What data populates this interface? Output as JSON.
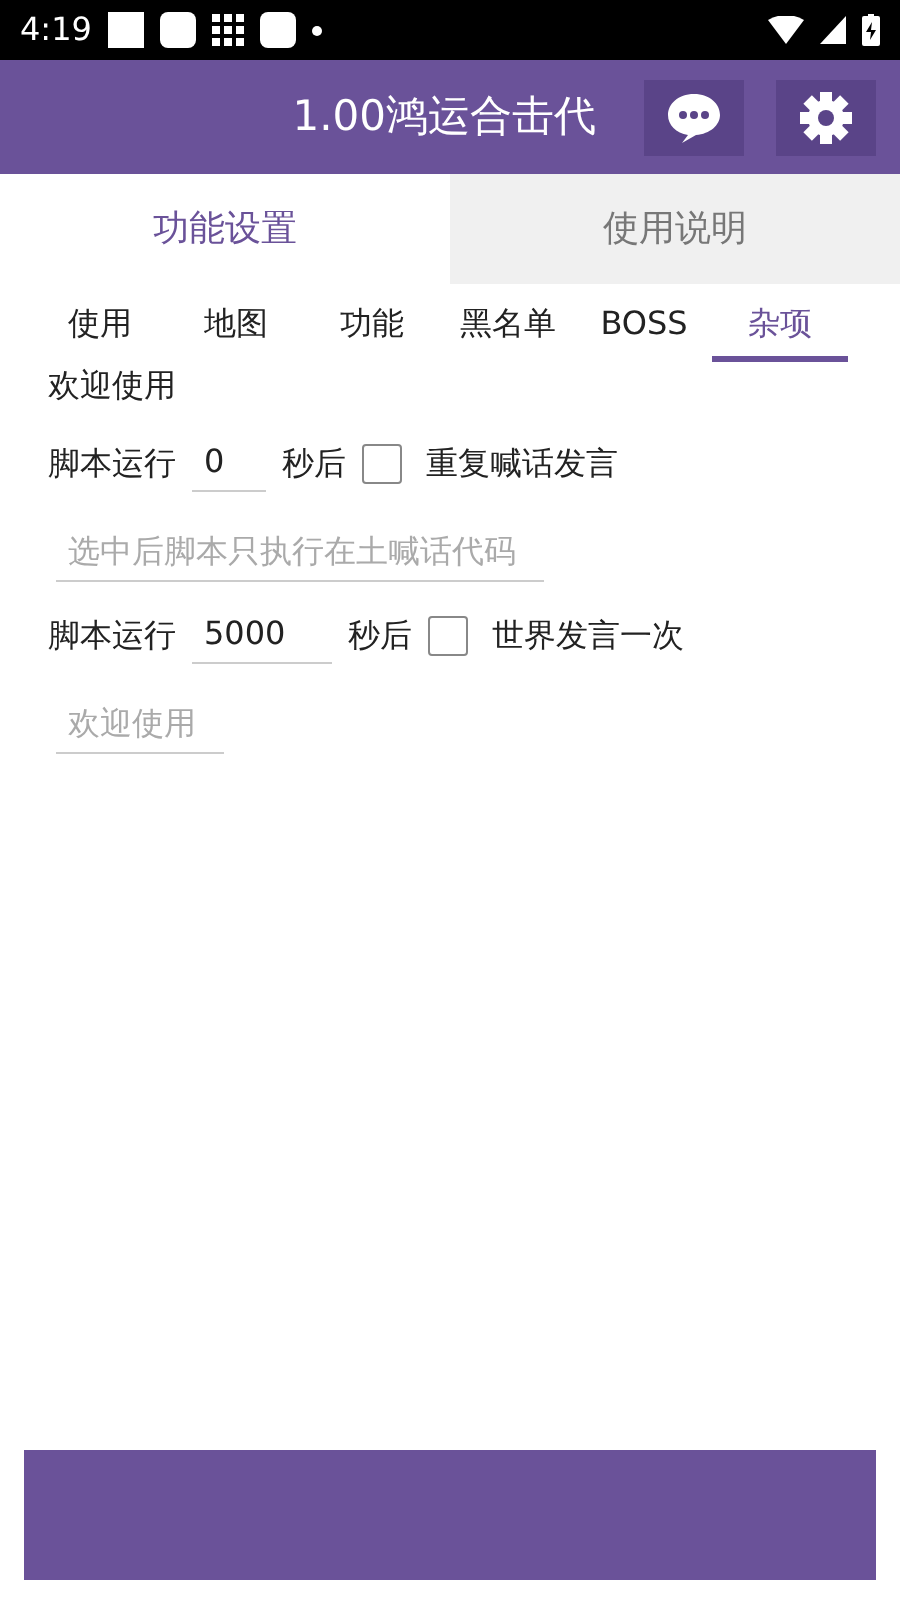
{
  "status_bar": {
    "time": "4:19"
  },
  "app_bar": {
    "title": "1.00鸿运合击代"
  },
  "tabs": [
    {
      "label": "功能设置",
      "selected": true
    },
    {
      "label": "使用说明",
      "selected": false
    }
  ],
  "subtabs": [
    {
      "label": "使用",
      "selected": false
    },
    {
      "label": "地图",
      "selected": false
    },
    {
      "label": "功能",
      "selected": false
    },
    {
      "label": "黑名单",
      "selected": false
    },
    {
      "label": "BOSS",
      "selected": false
    },
    {
      "label": "杂项",
      "selected": true
    }
  ],
  "greeting": "欢迎使用",
  "rows": [
    {
      "kind": "timer",
      "prefix": "脚本运行",
      "value": "0",
      "suffix": "秒后",
      "checked": false,
      "check_label": "重复喊话发言"
    },
    {
      "kind": "field",
      "placeholder": "选中后脚本只执行在土喊话代码"
    },
    {
      "kind": "timer",
      "prefix": "脚本运行",
      "value": "5000",
      "suffix": "秒后",
      "checked": false,
      "check_label": "世界发言一次"
    },
    {
      "kind": "field",
      "placeholder": "欢迎使用"
    }
  ]
}
